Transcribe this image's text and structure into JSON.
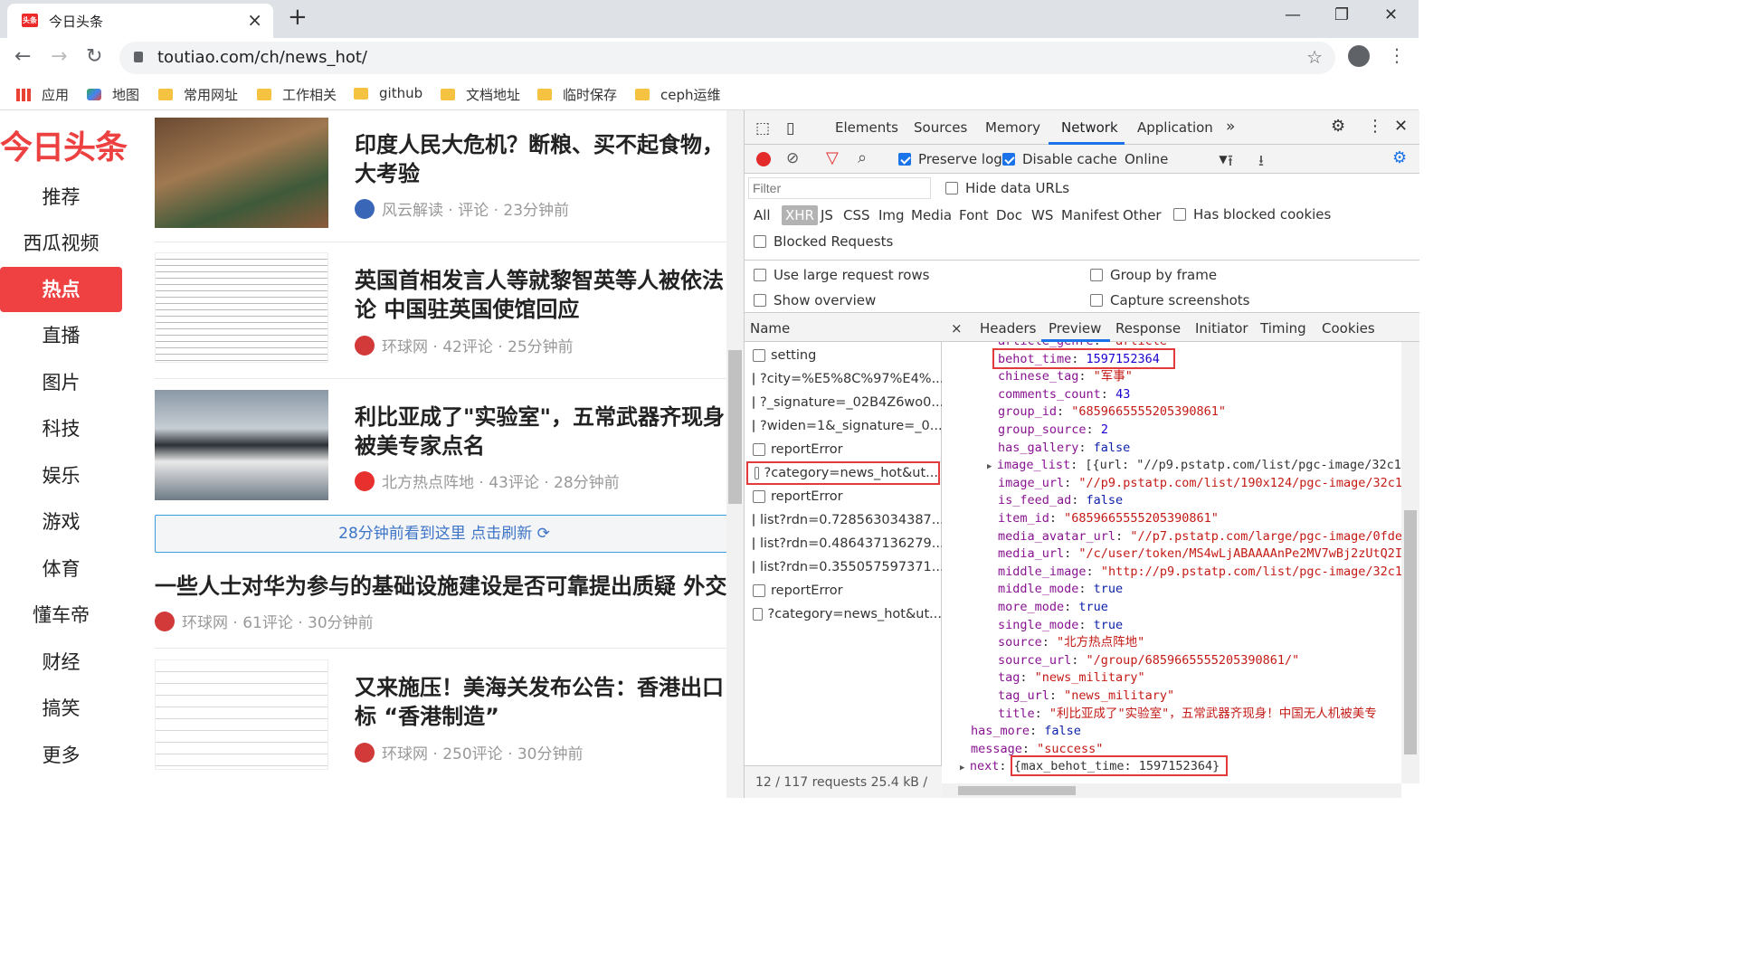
{
  "browser": {
    "tab_title": "今日头条",
    "favicon_text": "头条",
    "url": "toutiao.com/ch/news_hot/",
    "bookmarks": [
      "应用",
      "地图",
      "常用网址",
      "工作相关",
      "github",
      "文档地址",
      "临时保存",
      "ceph运维"
    ]
  },
  "site": {
    "logo": "今日头条",
    "nav": [
      "推荐",
      "西瓜视频",
      "热点",
      "直播",
      "图片",
      "科技",
      "娱乐",
      "游戏",
      "体育",
      "懂车帝",
      "财经",
      "搞笑",
      "更多"
    ],
    "active_nav": "热点",
    "articles": [
      {
        "title_line1": "印度人民大危机？断粮、买不起食物，",
        "title_line2": "大考验",
        "meta": "风云解读 · 评论 · 23分钟前"
      },
      {
        "title_line1": "英国首相发言人等就黎智英等人被依法",
        "title_line2": "论 中国驻英国使馆回应",
        "meta": "环球网 · 42评论 · 25分钟前"
      },
      {
        "title_line1": "利比亚成了\"实验室\"，五常武器齐现身",
        "title_line2": "被美专家点名",
        "meta": "北方热点阵地 · 43评论 · 28分钟前"
      },
      {
        "title_line1": "一些人士对华为参与的基础设施建设是否可靠提出质疑 外交",
        "meta": "环球网 · 61评论 · 30分钟前"
      },
      {
        "title_line1": "又来施压！美海关发布公告：香港出口",
        "title_line2": "标 “香港制造”",
        "meta": "环球网 · 250评论 · 30分钟前"
      }
    ],
    "refresh_text": "28分钟前看到这里   点击刷新 ⟳"
  },
  "devtools": {
    "tabs": [
      "Elements",
      "Sources",
      "Memory",
      "Network",
      "Application",
      "»"
    ],
    "active_tab": "Network",
    "preserve_log": "Preserve log",
    "disable_cache": "Disable cache",
    "throttle": "Online",
    "filter_placeholder": "Filter",
    "hide_data_urls": "Hide data URLs",
    "filter_types": [
      "All",
      "XHR",
      "JS",
      "CSS",
      "Img",
      "Media",
      "Font",
      "Doc",
      "WS",
      "Manifest",
      "Other"
    ],
    "has_blocked_cookies": "Has blocked cookies",
    "blocked_requests": "Blocked Requests",
    "use_large_rows": "Use large request rows",
    "group_by_frame": "Group by frame",
    "show_overview": "Show overview",
    "capture_screenshots": "Capture screenshots",
    "name_header": "Name",
    "requests": [
      "setting",
      "?city=%E5%8C%97%E4%...",
      "?_signature=_02B4Z6wo0...",
      "?widen=1&_signature=_0...",
      "reportError",
      "?category=news_hot&ut...",
      "reportError",
      "list?rdn=0.728563034387...",
      "list?rdn=0.486437136279...",
      "list?rdn=0.355057597371...",
      "reportError",
      "?category=news_hot&ut..."
    ],
    "footer": "12 / 117 requests   25.4 kB / ",
    "detail_tabs": [
      "×",
      "Headers",
      "Preview",
      "Response",
      "Initiator",
      "Timing",
      "Cookies"
    ],
    "json_lines": [
      {
        "k": "article_genre",
        "v": "\"article\"",
        "t": "s"
      },
      {
        "k": "behot_time",
        "v": "1597152364",
        "t": "n"
      },
      {
        "k": "chinese_tag",
        "v": "\"军事\"",
        "t": "s"
      },
      {
        "k": "comments_count",
        "v": "43",
        "t": "n"
      },
      {
        "k": "group_id",
        "v": "\"6859665555205390861\"",
        "t": "s"
      },
      {
        "k": "group_source",
        "v": "2",
        "t": "n"
      },
      {
        "k": "has_gallery",
        "v": "false",
        "t": "b"
      },
      {
        "k": "image_list",
        "v": "[{url: \"//p9.pstatp.com/list/pgc-image/32c1",
        "t": "p"
      },
      {
        "k": "image_url",
        "v": "\"//p9.pstatp.com/list/190x124/pgc-image/32c1",
        "t": "s"
      },
      {
        "k": "is_feed_ad",
        "v": "false",
        "t": "b"
      },
      {
        "k": "item_id",
        "v": "\"6859665555205390861\"",
        "t": "s"
      },
      {
        "k": "media_avatar_url",
        "v": "\"//p7.pstatp.com/large/pgc-image/0fde",
        "t": "s"
      },
      {
        "k": "media_url",
        "v": "\"/c/user/token/MS4wLjABAAAAnPe2MV7wBj2zUtQ2I",
        "t": "s"
      },
      {
        "k": "middle_image",
        "v": "\"http://p9.pstatp.com/list/pgc-image/32c1",
        "t": "s"
      },
      {
        "k": "middle_mode",
        "v": "true",
        "t": "b"
      },
      {
        "k": "more_mode",
        "v": "true",
        "t": "b"
      },
      {
        "k": "single_mode",
        "v": "true",
        "t": "b"
      },
      {
        "k": "source",
        "v": "\"北方热点阵地\"",
        "t": "s"
      },
      {
        "k": "source_url",
        "v": "\"/group/6859665555205390861/\"",
        "t": "s"
      },
      {
        "k": "tag",
        "v": "\"news_military\"",
        "t": "s"
      },
      {
        "k": "tag_url",
        "v": "\"news_military\"",
        "t": "s"
      },
      {
        "k": "title",
        "v": "\"利比亚成了\"实验室\"，五常武器齐现身！中国无人机被美专",
        "t": "s"
      }
    ],
    "root_lines": [
      {
        "k": "has_more",
        "v": "false",
        "t": "b"
      },
      {
        "k": "message",
        "v": "\"success\"",
        "t": "s"
      },
      {
        "k": "next",
        "v": "{max_behot_time: 1597152364}",
        "t": "p"
      }
    ]
  }
}
